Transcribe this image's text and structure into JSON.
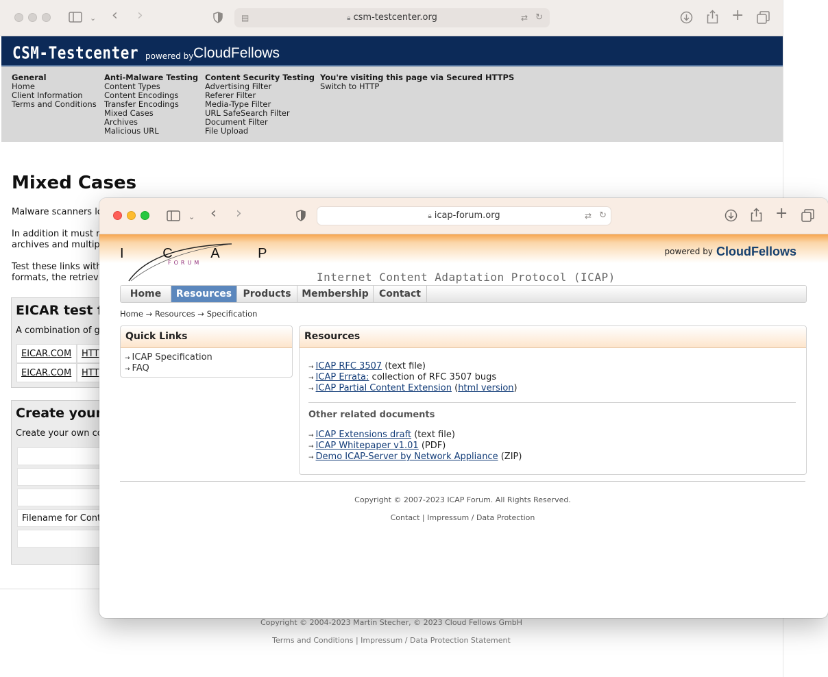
{
  "back_window": {
    "url": "csm-testcenter.org",
    "logo": "CSM-Testcenter",
    "powered_by": "powered by",
    "brand": "CloudFellows",
    "nav": [
      {
        "heading": "General",
        "items": [
          "Home",
          "Client Information",
          "Terms and Conditions"
        ]
      },
      {
        "heading": "Anti-Malware Testing",
        "items": [
          "Content Types",
          "Content Encodings",
          "Transfer Encodings",
          "Mixed Cases",
          "Archives",
          "Malicious URL"
        ]
      },
      {
        "heading": "Content Security Testing",
        "items": [
          "Advertising Filter",
          "Referer Filter",
          "Media-Type Filter",
          "URL SafeSearch Filter",
          "Document Filter",
          "File Upload"
        ]
      },
      {
        "heading": "You're visiting this page via Secured HTTPS",
        "items": [
          "Switch to HTTP"
        ]
      }
    ],
    "page_title": "Mixed Cases",
    "paragraphs": [
      "Malware scanners lo",
      "In addition it must r",
      "archives and multip",
      "Test these links with",
      "formats, the retriev"
    ],
    "eicar_box": {
      "heading": "EICAR test f",
      "text": "A combination of g",
      "rows": [
        [
          "EICAR.COM",
          "HTT"
        ],
        [
          "EICAR.COM",
          "HTT"
        ]
      ]
    },
    "create_box": {
      "heading": "Create your",
      "text": "Create your own co",
      "rows": [
        "",
        "",
        "",
        "Filename for Cont",
        ""
      ]
    },
    "footer": {
      "copyright": "Copyright © 2004-2023 Martin Stecher, © 2023 Cloud Fellows GmbH",
      "links": "Terms and Conditions | Impressum / Data Protection Statement"
    }
  },
  "front_window": {
    "url": "icap-forum.org",
    "logo_letters": "I   C   A   P",
    "logo_forum": "FORUM",
    "powered_by": "powered by",
    "brand": "CloudFellows",
    "subtitle": "Internet Content Adaptation Protocol (ICAP)",
    "nav": [
      "Home",
      "Resources",
      "Products",
      "Membership",
      "Contact"
    ],
    "nav_active": "Resources",
    "breadcrumb": "Home → Resources → Specification",
    "quick_links": {
      "title": "Quick Links",
      "items": [
        "ICAP Specification",
        "FAQ"
      ]
    },
    "resources": {
      "title": "Resources",
      "items": [
        {
          "link": "ICAP RFC 3507",
          "after": " (text file)"
        },
        {
          "link": "ICAP Errata:",
          "after": " collection of RFC 3507 bugs"
        },
        {
          "link": "ICAP Partial Content Extension",
          "after": " (",
          "link2": "html version",
          "after2": ")"
        }
      ],
      "other_heading": "Other related documents",
      "other_items": [
        {
          "link": "ICAP Extensions draft",
          "after": " (text file)"
        },
        {
          "link": "ICAP Whitepaper v1.01",
          "after": " (PDF)"
        },
        {
          "link": "Demo ICAP-Server by Network Appliance",
          "after": " (ZIP)"
        }
      ]
    },
    "footer": {
      "copyright": "Copyright © 2007-2023 ICAP Forum. All Rights Reserved.",
      "links": "Contact | Impressum / Data Protection"
    }
  }
}
